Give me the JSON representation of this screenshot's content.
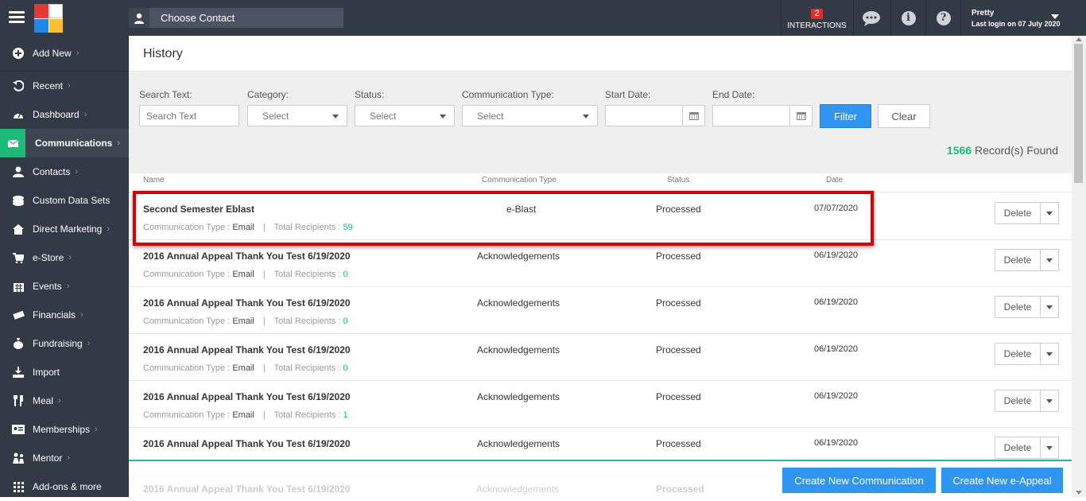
{
  "topbar": {
    "contact_placeholder": "Choose Contact",
    "interactions_count": "2",
    "interactions_label": "INTERACTIONS",
    "info_glyph": "i",
    "help_glyph": "?",
    "user_name": "Pretty",
    "last_login": "Last login on 07 July 2020"
  },
  "sidebar": {
    "items": [
      {
        "label": "Add New",
        "icon": "plus-circle-icon"
      },
      {
        "label": "Recent",
        "icon": "history-icon"
      },
      {
        "label": "Dashboard",
        "icon": "dashboard-icon"
      },
      {
        "label": "Communications",
        "icon": "envelope-icon"
      },
      {
        "label": "Contacts",
        "icon": "user-icon"
      },
      {
        "label": "Custom Data Sets",
        "icon": "database-icon"
      },
      {
        "label": "Direct Marketing",
        "icon": "home-icon"
      },
      {
        "label": "e-Store",
        "icon": "cart-icon"
      },
      {
        "label": "Events",
        "icon": "calendar-icon"
      },
      {
        "label": "Financials",
        "icon": "money-icon"
      },
      {
        "label": "Fundraising",
        "icon": "moneybag-icon"
      },
      {
        "label": "Import",
        "icon": "import-icon"
      },
      {
        "label": "Meal",
        "icon": "cutlery-icon"
      },
      {
        "label": "Memberships",
        "icon": "id-card-icon"
      },
      {
        "label": "Mentor",
        "icon": "mentor-icon"
      },
      {
        "label": "Add-ons & more",
        "icon": "grid-icon"
      }
    ]
  },
  "page": {
    "title": "History",
    "records_count": "1566",
    "records_label": "Record(s) Found"
  },
  "filters": {
    "search_label": "Search Text:",
    "search_placeholder": "Search Text",
    "category_label": "Category:",
    "category_value": "Select",
    "status_label": "Status:",
    "status_value": "Select",
    "comm_type_label": "Communication Type:",
    "comm_type_value": "Select",
    "start_label": "Start Date:",
    "end_label": "End Date:",
    "filter_button": "Filter",
    "clear_button": "Clear"
  },
  "table": {
    "headers": {
      "name": "Name",
      "type": "Communication Type",
      "status": "Status",
      "date": "Date"
    },
    "sub_type_label": "Communication Type :",
    "sub_recip_label": "Total Recipients :",
    "sep": "|",
    "delete_label": "Delete",
    "rows": [
      {
        "name": "Second Semester Eblast",
        "type": "e-Blast",
        "status": "Processed",
        "date": "07/07/2020",
        "sub_type": "Email",
        "recipients": "59"
      },
      {
        "name": "2016 Annual Appeal Thank You Test 6/19/2020",
        "type": "Acknowledgements",
        "status": "Processed",
        "date": "06/19/2020",
        "sub_type": "Email",
        "recipients": "0"
      },
      {
        "name": "2016 Annual Appeal Thank You Test 6/19/2020",
        "type": "Acknowledgements",
        "status": "Processed",
        "date": "06/19/2020",
        "sub_type": "Email",
        "recipients": "0"
      },
      {
        "name": "2016 Annual Appeal Thank You Test 6/19/2020",
        "type": "Acknowledgements",
        "status": "Processed",
        "date": "06/19/2020",
        "sub_type": "Email",
        "recipients": "0"
      },
      {
        "name": "2016 Annual Appeal Thank You Test 6/19/2020",
        "type": "Acknowledgements",
        "status": "Processed",
        "date": "06/19/2020",
        "sub_type": "Email",
        "recipients": "1"
      },
      {
        "name": "2016 Annual Appeal Thank You Test 6/19/2020",
        "type": "Acknowledgements",
        "status": "Processed",
        "date": "06/19/2020",
        "sub_type": "",
        "recipients": ""
      }
    ],
    "faded_row": {
      "name": "2016 Annual Appeal Thank You Test 6/19/2020",
      "type": "Acknowledgements",
      "status": "Processed"
    }
  },
  "actions": {
    "create_communication": "Create New Communication",
    "create_eappeal": "Create New e-Appeal"
  },
  "colors": {
    "accent_green": "#1abc78",
    "primary_blue": "#2e96f0",
    "sidebar_bg": "#323a45",
    "highlight_red": "#dd0000"
  }
}
